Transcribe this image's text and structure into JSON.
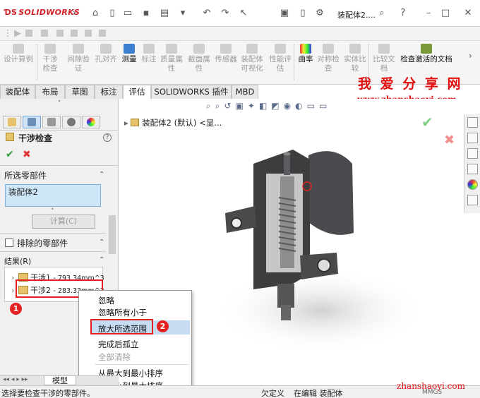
{
  "app": {
    "logo_text": "SOLIDWORKS",
    "document_title": "装配体2...."
  },
  "ribbon": {
    "buttons": [
      {
        "label": "设计算例",
        "active": false
      },
      {
        "label": "干涉检查",
        "active": false
      },
      {
        "label": "间隙验证",
        "active": false
      },
      {
        "label": "孔对齐",
        "active": false
      },
      {
        "label": "测量",
        "active": true
      },
      {
        "label": "标注",
        "active": false
      },
      {
        "label": "质量属性",
        "active": false
      },
      {
        "label": "截面属性",
        "active": false
      },
      {
        "label": "传感器",
        "active": false
      },
      {
        "label": "装配体可视化",
        "active": false
      },
      {
        "label": "性能评估",
        "active": false
      },
      {
        "label": "曲率",
        "active": true
      },
      {
        "label": "对称检查",
        "active": false
      },
      {
        "label": "实体比较",
        "active": false
      },
      {
        "label": "比较文档",
        "active": false
      },
      {
        "label": "检查激活的文档",
        "active": true
      }
    ]
  },
  "tabs": [
    "装配体",
    "布局",
    "草图",
    "标注",
    "评估",
    "SOLIDWORKS 插件",
    "MBD"
  ],
  "selected_tab": "评估",
  "watermark": {
    "line1": "我 爱 分 享 网",
    "line2": "www.zhanshaoyi.com",
    "line3": "zhanshaoyi.com"
  },
  "property_manager": {
    "title": "干涉检查",
    "help": "?",
    "selected_components_label": "所选零部件",
    "selected_component_value": "装配体2",
    "calculate_label": "计算(C)",
    "excluded_label": "排除的零部件",
    "results_label": "结果(R)",
    "results": [
      {
        "name": "干涉1",
        "value": "- 793.34mm^3"
      },
      {
        "name": "干涉2",
        "value": "- 283.33mm^3"
      }
    ]
  },
  "annotations": {
    "badge1": "1",
    "badge2": "2"
  },
  "context_menu": {
    "items": [
      {
        "label": "忽略",
        "disabled": false
      },
      {
        "label": "忽略所有小于",
        "disabled": false
      },
      {
        "label": "放大所选范围",
        "disabled": false,
        "highlighted": true
      },
      {
        "label": "完成后孤立",
        "disabled": false
      },
      {
        "label": "全部清除",
        "disabled": true
      },
      {
        "label": "从最大到最小排序",
        "disabled": false
      },
      {
        "label": "从最小到最大排序",
        "disabled": false
      }
    ]
  },
  "graphics": {
    "tree_root": "装配体2 (默认) <显..."
  },
  "bottom_tab": "模型",
  "status": {
    "left": "选择要检查干涉的零部件。",
    "mid1": "欠定义",
    "mid2": "在编辑 装配体",
    "units": "MMGS"
  },
  "colors": {
    "accent_red": "#e52020",
    "selection_blue": "#cde6f8",
    "ok_green": "#2f9a2f"
  }
}
